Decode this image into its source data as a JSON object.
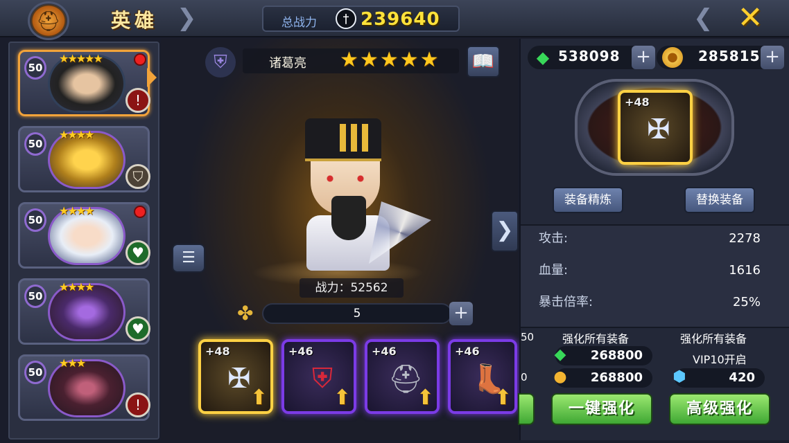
{
  "header": {
    "title": "英雄",
    "total_power_label": "总战力",
    "total_power_value": "239640"
  },
  "hero_list": [
    {
      "level": "50",
      "stars": "★★★★★",
      "status": "alert",
      "status_glyph": "!",
      "red_dot": true,
      "selected": true
    },
    {
      "level": "50",
      "stars": "★★★★",
      "status": "shield",
      "status_glyph": "⛉",
      "red_dot": false,
      "selected": false
    },
    {
      "level": "50",
      "stars": "★★★★",
      "status": "heal",
      "status_glyph": "♥",
      "red_dot": true,
      "selected": false
    },
    {
      "level": "50",
      "stars": "★★★★",
      "status": "heal",
      "status_glyph": "♥",
      "red_dot": false,
      "selected": false
    },
    {
      "level": "50",
      "stars": "★★★",
      "status": "alert",
      "status_glyph": "!",
      "red_dot": false,
      "selected": false
    }
  ],
  "hero": {
    "name": "诸葛亮",
    "stars": "★★★★★",
    "combat_power": "战力：52562",
    "fragments": "5"
  },
  "equipment": [
    {
      "level": "+48",
      "rarity": "gold",
      "icon": "staff-icon",
      "glyph": "✠"
    },
    {
      "level": "+46",
      "rarity": "purple",
      "icon": "armor-icon",
      "glyph": "⛨"
    },
    {
      "level": "+46",
      "rarity": "purple",
      "icon": "helmet-icon",
      "glyph": "⛑"
    },
    {
      "level": "+46",
      "rarity": "purple",
      "icon": "boots-icon",
      "glyph": "👢"
    }
  ],
  "currency": {
    "gems": "538098",
    "gold": "285815"
  },
  "selected_equipment": {
    "level": "+48",
    "icon": "staff-icon"
  },
  "buttons": {
    "refine": "装备精炼",
    "replace": "替换装备",
    "one_click": "一键强化",
    "advanced": "高级强化"
  },
  "stats": [
    {
      "label": "攻击:",
      "value": "2278"
    },
    {
      "label": "血量:",
      "value": "1616"
    },
    {
      "label": "暴击倍率:",
      "value": "25%"
    }
  ],
  "enhance": {
    "left_partial_1": "50",
    "left_partial_2": "0",
    "title_1": "强化所有装备",
    "gem_cost": "268800",
    "gold_cost": "268800",
    "title_2": "强化所有装备",
    "vip_note": "VIP10开启",
    "crystal_cost": "420"
  },
  "colors": {
    "gold_accent": "#ffe23a",
    "selected_border": "#f2a33a",
    "purple_rarity": "#7b3be6",
    "green_button": "#3fa834"
  }
}
